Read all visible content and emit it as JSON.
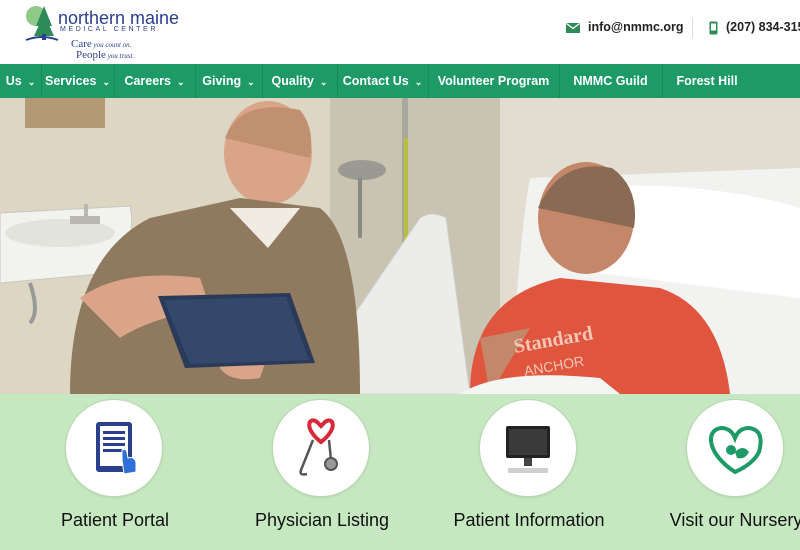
{
  "header": {
    "logo": {
      "name": "northern maine",
      "sub": "MEDICAL CENTER",
      "tag_line1_big": "Care",
      "tag_line1_small": " you count on.",
      "tag_line2_big": "People",
      "tag_line2_small": " you trust."
    },
    "email": "info@nmmc.org",
    "phone": "(207) 834-315"
  },
  "nav": {
    "items": [
      {
        "label": "Us",
        "dropdown": true
      },
      {
        "label": "Services",
        "dropdown": true
      },
      {
        "label": "Careers",
        "dropdown": true
      },
      {
        "label": "Giving",
        "dropdown": true
      },
      {
        "label": "Quality",
        "dropdown": true
      },
      {
        "label": "Contact Us",
        "dropdown": true
      },
      {
        "label": "Volunteer Program",
        "dropdown": false
      },
      {
        "label": "NMMC Guild",
        "dropdown": false
      },
      {
        "label": "Forest Hill",
        "dropdown": false
      }
    ]
  },
  "tiles": [
    {
      "label": "Patient Portal",
      "icon": "tablet-touch-icon"
    },
    {
      "label": "Physician Listing",
      "icon": "stethoscope-heart-icon"
    },
    {
      "label": "Patient Information",
      "icon": "computer-monitor-icon"
    },
    {
      "label": "Visit our Nursery",
      "icon": "baby-heart-icon"
    }
  ],
  "colors": {
    "nav_green": "#1d9a66",
    "tile_bg": "#c6e8c0",
    "brand_blue": "#2b3f8f",
    "brand_green": "#2e8b57"
  }
}
